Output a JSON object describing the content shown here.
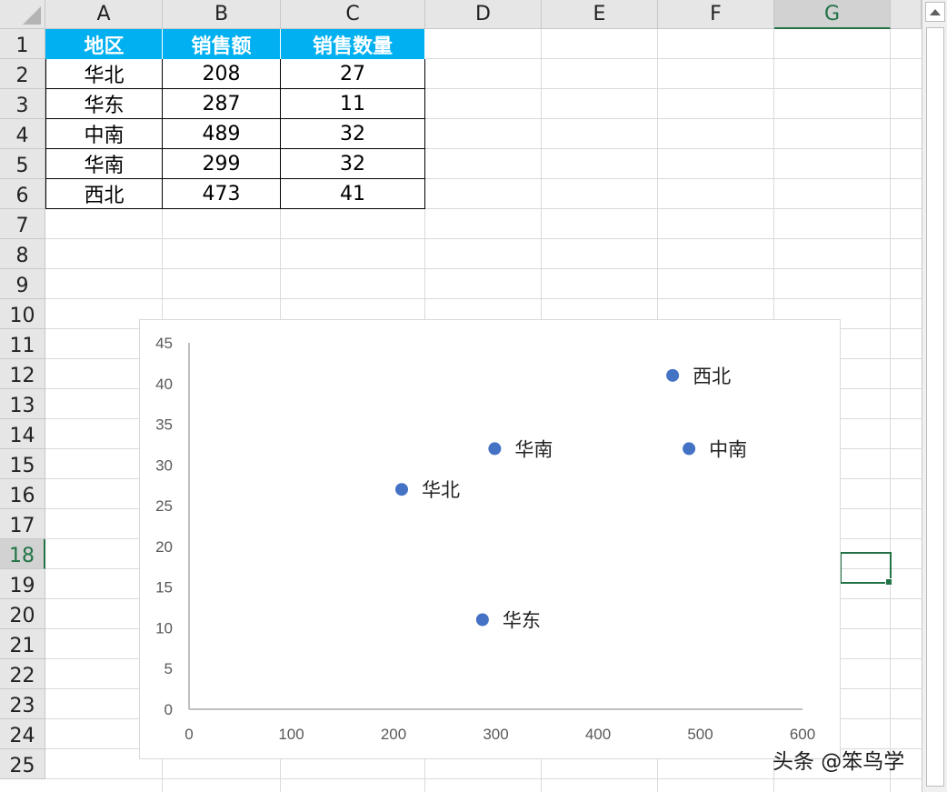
{
  "columns": [
    "A",
    "B",
    "C",
    "D",
    "E",
    "F",
    "G"
  ],
  "active_column": "G",
  "rows": [
    "1",
    "2",
    "3",
    "4",
    "5",
    "6",
    "7",
    "8",
    "9",
    "10",
    "11",
    "12",
    "13",
    "14",
    "15",
    "16",
    "17",
    "18",
    "19",
    "20",
    "21",
    "22",
    "23",
    "24",
    "25"
  ],
  "active_row": "18",
  "table": {
    "headers": [
      "地区",
      "销售额",
      "销售数量"
    ],
    "rows": [
      [
        "华北",
        "208",
        "27"
      ],
      [
        "华东",
        "287",
        "11"
      ],
      [
        "中南",
        "489",
        "32"
      ],
      [
        "华南",
        "299",
        "32"
      ],
      [
        "西北",
        "473",
        "41"
      ]
    ],
    "header_color": "#00b0f0"
  },
  "chart_data": {
    "type": "scatter",
    "title": "",
    "xlabel": "",
    "ylabel": "",
    "xlim": [
      0,
      600
    ],
    "ylim": [
      0,
      45
    ],
    "x_ticks": [
      "0",
      "100",
      "200",
      "300",
      "400",
      "500",
      "600"
    ],
    "y_ticks": [
      "0",
      "5",
      "10",
      "15",
      "20",
      "25",
      "30",
      "35",
      "40",
      "45"
    ],
    "grid": false,
    "marker_color": "#4472c4",
    "points": [
      {
        "label": "华北",
        "x": 208,
        "y": 27
      },
      {
        "label": "华东",
        "x": 287,
        "y": 11
      },
      {
        "label": "中南",
        "x": 489,
        "y": 32
      },
      {
        "label": "华南",
        "x": 299,
        "y": 32
      },
      {
        "label": "西北",
        "x": 473,
        "y": 41
      }
    ]
  },
  "watermark": "头条 @笨鸟学"
}
